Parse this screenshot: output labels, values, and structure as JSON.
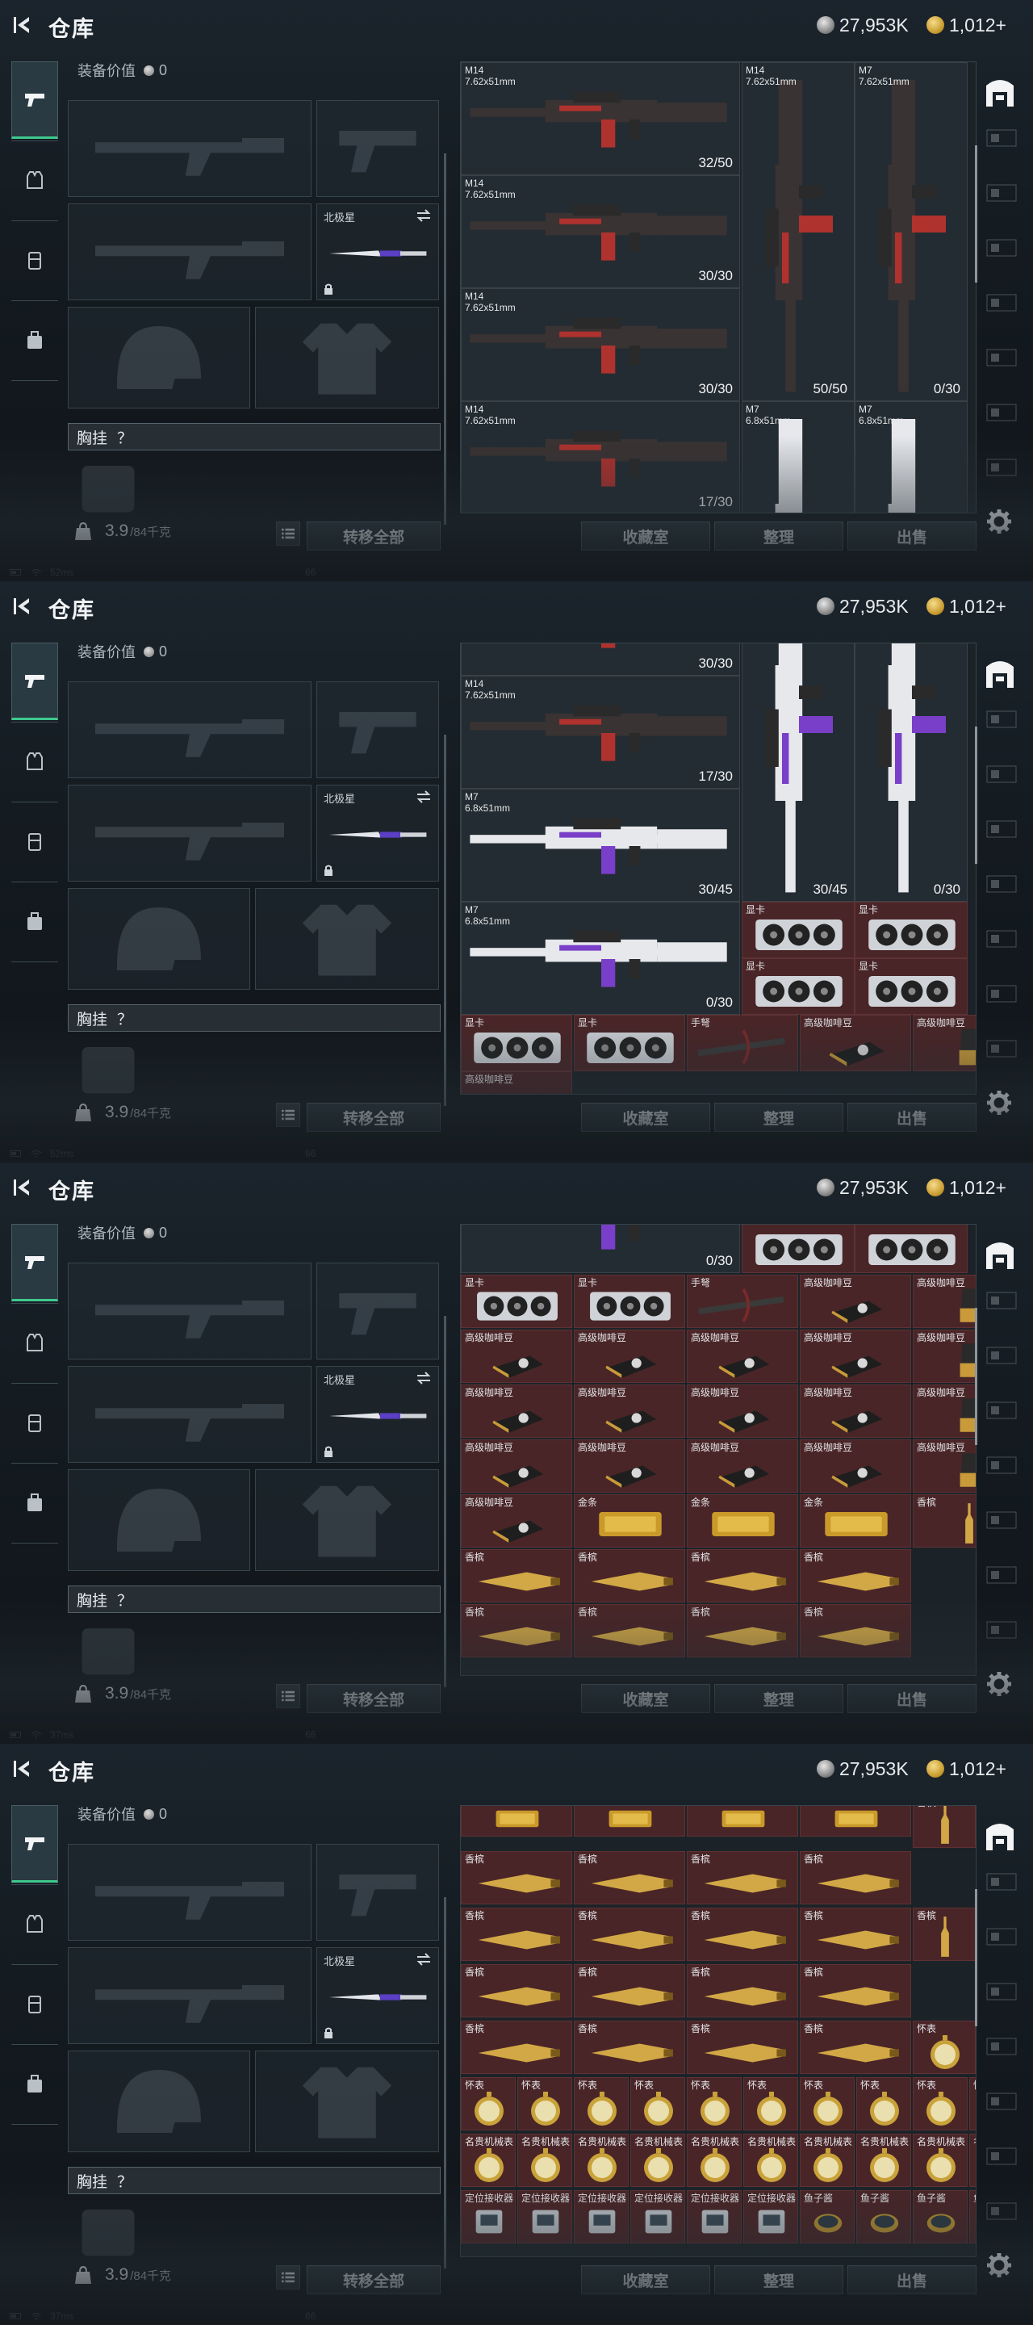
{
  "header": {
    "title": "仓库",
    "silver_amount": "27,953K",
    "gold_amount": "1,012+"
  },
  "equipment": {
    "value_label": "装备价值",
    "value": "0",
    "melee_name": "北极星",
    "chest_label": "胸挂",
    "chest_question": "？"
  },
  "footer": {
    "weight_current": "3.9",
    "weight_max": "/84千克",
    "transfer_all": "转移全部",
    "collection_room": "收藏室",
    "sort": "整理",
    "sell": "出售"
  },
  "status": [
    {
      "ping": "52ms",
      "fps": "66"
    },
    {
      "ping": "52ms",
      "fps": "66"
    },
    {
      "ping": "37ms",
      "fps": "66"
    },
    {
      "ping": "37ms",
      "fps": "66"
    }
  ],
  "frames": [
    {
      "cells": [
        {
          "x": 0,
          "y": 0,
          "w": 2,
          "h": 1,
          "bg": "w",
          "label": "M14\n7.62x51mm",
          "count": "32/50",
          "icon": "rifle-red"
        },
        {
          "x": 2,
          "y": 0,
          "w": 1,
          "h": 3,
          "bg": "w",
          "label": "M14\n7.62x51mm",
          "count": "50/50",
          "icon": "rifle-red-v"
        },
        {
          "x": 3,
          "y": 0,
          "w": 1,
          "h": 3,
          "bg": "w",
          "label": "M7\n7.62x51mm",
          "count": "0/30",
          "icon": "rifle-red-v"
        },
        {
          "x": 0,
          "y": 1,
          "w": 2,
          "h": 1,
          "bg": "w",
          "label": "M14\n7.62x51mm",
          "count": "30/30",
          "icon": "rifle-red"
        },
        {
          "x": 0,
          "y": 2,
          "w": 2,
          "h": 1,
          "bg": "w",
          "label": "M14\n7.62x51mm",
          "count": "30/30",
          "icon": "rifle-red"
        },
        {
          "x": 0,
          "y": 3,
          "w": 2,
          "h": 1,
          "bg": "w",
          "label": "M14\n7.62x51mm",
          "count": "17/30",
          "icon": "rifle-red"
        },
        {
          "x": 2,
          "y": 3,
          "w": 1,
          "h": 3,
          "bg": "w",
          "label": "M7\n6.8x51mm",
          "count": "",
          "icon": "rifle-white-v"
        },
        {
          "x": 3,
          "y": 3,
          "w": 1,
          "h": 3,
          "bg": "w",
          "label": "M7\n6.8x51mm",
          "count": "",
          "icon": "rifle-white-v"
        }
      ]
    },
    {
      "cells": [
        {
          "x": 0,
          "y": 0,
          "w": 2,
          "h": 1,
          "bg": "w",
          "label": "",
          "count": "30/30",
          "icon": "rifle-red"
        },
        {
          "x": 2,
          "y": 0,
          "w": 1,
          "h": 3,
          "bg": "w",
          "label": "",
          "count": "30/45",
          "icon": "rifle-white-v"
        },
        {
          "x": 3,
          "y": 0,
          "w": 1,
          "h": 3,
          "bg": "w",
          "label": "",
          "count": "0/30",
          "icon": "rifle-white-v"
        },
        {
          "x": 0,
          "y": 1,
          "w": 2,
          "h": 1,
          "bg": "w",
          "label": "M14\n7.62x51mm",
          "count": "17/30",
          "icon": "rifle-red"
        },
        {
          "x": 0,
          "y": 2,
          "w": 2,
          "h": 1,
          "bg": "w",
          "label": "M7\n6.8x51mm",
          "count": "30/45",
          "icon": "rifle-white"
        },
        {
          "x": 0,
          "y": 3,
          "w": 2,
          "h": 1,
          "bg": "w",
          "label": "M7\n6.8x51mm",
          "count": "0/30",
          "icon": "rifle-white"
        },
        {
          "x": 2,
          "y": 3,
          "w": 1,
          "h": 1,
          "bg": "r",
          "label": "显卡",
          "count": "",
          "icon": "gpu"
        },
        {
          "x": 3,
          "y": 3,
          "w": 1,
          "h": 1,
          "bg": "r",
          "label": "显卡",
          "count": "",
          "icon": "gpu"
        },
        {
          "x": 2,
          "y": 4,
          "w": 1,
          "h": 1,
          "bg": "r",
          "label": "显卡",
          "count": "",
          "icon": "gpu"
        },
        {
          "x": 3,
          "y": 4,
          "w": 1,
          "h": 1,
          "bg": "r",
          "label": "显卡",
          "count": "",
          "icon": "gpu"
        },
        {
          "x": 0,
          "y": 5,
          "w": 0.5,
          "h": 1,
          "bg": "r",
          "label": "显卡",
          "count": "",
          "icon": "gpu"
        },
        {
          "x": 0.5,
          "y": 5,
          "w": 0.5,
          "h": 1,
          "bg": "r",
          "label": "显卡",
          "count": "",
          "icon": "gpu"
        },
        {
          "x": 1,
          "y": 5,
          "w": 0.5,
          "h": 1,
          "bg": "r",
          "label": "手弩",
          "count": "",
          "icon": "crossbow"
        },
        {
          "x": 1.5,
          "y": 5,
          "w": 0.5,
          "h": 1,
          "bg": "r",
          "label": "高级咖啡豆",
          "count": "",
          "icon": "coffee"
        },
        {
          "x": 2,
          "y": 5,
          "w": 0.5,
          "h": 1,
          "bg": "r",
          "label": "高级咖啡豆",
          "count": "",
          "icon": "coffee-bag"
        },
        {
          "x": 0,
          "y": 6,
          "w": 0.5,
          "h": 1,
          "bg": "r",
          "label": "高级咖啡豆",
          "count": "",
          "icon": "coffee"
        }
      ]
    },
    {
      "cells": [
        {
          "x": 0,
          "y": 0,
          "w": 2,
          "h": 1,
          "bg": "w",
          "label": "",
          "count": "0/30",
          "icon": "rifle-white"
        },
        {
          "x": 2,
          "y": 0,
          "w": 1,
          "h": 1,
          "bg": "r",
          "label": "",
          "count": "",
          "icon": "gpu"
        },
        {
          "x": 3,
          "y": 0,
          "w": 1,
          "h": 1,
          "bg": "r",
          "label": "",
          "count": "",
          "icon": "gpu"
        }
      ]
    },
    {
      "cells": []
    }
  ],
  "small_grid_rows": {
    "frame3": [
      [
        "显卡",
        "显卡",
        "手弩",
        "高级咖啡豆",
        "高级咖啡豆"
      ],
      [
        "高级咖啡豆",
        "高级咖啡豆",
        "高级咖啡豆",
        "高级咖啡豆",
        "高级咖啡豆"
      ],
      [
        "高级咖啡豆",
        "高级咖啡豆",
        "高级咖啡豆",
        "高级咖啡豆",
        "高级咖啡豆"
      ],
      [
        "高级咖啡豆",
        "高级咖啡豆",
        "高级咖啡豆",
        "高级咖啡豆",
        "高级咖啡豆"
      ],
      [
        "高级咖啡豆",
        "金条",
        "金条",
        "金条",
        "香槟"
      ],
      [
        "香槟",
        "香槟",
        "香槟",
        "香槟",
        ""
      ],
      [
        "香槟",
        "香槟",
        "香槟",
        "香槟",
        ""
      ]
    ],
    "frame4": [
      [
        "",
        "",
        "",
        "",
        "香槟"
      ],
      [
        "香槟",
        "香槟",
        "香槟",
        "香槟",
        ""
      ],
      [
        "香槟",
        "香槟",
        "香槟",
        "香槟",
        "香槟"
      ],
      [
        "香槟",
        "香槟",
        "香槟",
        "香槟",
        ""
      ],
      [
        "香槟",
        "香槟",
        "香槟",
        "香槟",
        "怀表"
      ],
      [
        "怀表",
        "怀表",
        "怀表",
        "怀表",
        "怀表"
      ],
      [
        "名贵机械表",
        "名贵机械表",
        "名贵机械表",
        "名贵机械表",
        "名贵机械表"
      ],
      [
        "定位接收器",
        "定位接收器",
        "定位接收器",
        "鱼子酱",
        "鱼子酱"
      ]
    ]
  },
  "colors": {
    "accent_green": "#3ec98e",
    "item_red": "#4a2527",
    "panel": "#232c32"
  }
}
